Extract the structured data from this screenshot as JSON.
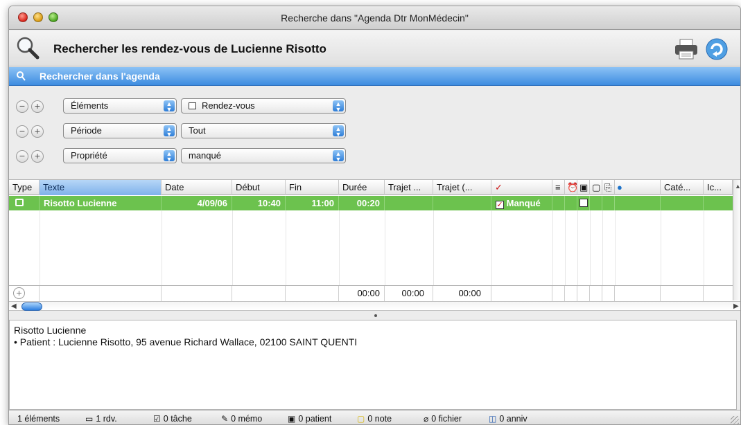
{
  "window": {
    "title": "Recherche dans \"Agenda Dtr MonMédecin\""
  },
  "header": {
    "title": "Rechercher les rendez-vous de Lucienne Risotto",
    "icons": {
      "search": "magnifier-icon",
      "print": "printer-icon",
      "refresh": "refresh-icon"
    }
  },
  "searchbar": {
    "label": "Rechercher dans l'agenda"
  },
  "criteria": [
    {
      "field": "Éléments",
      "value": "Rendez-vous"
    },
    {
      "field": "Période",
      "value": "Tout"
    },
    {
      "field": "Propriété",
      "value": "manqué"
    }
  ],
  "table": {
    "columns": [
      "Type",
      "Texte",
      "Date",
      "Début",
      "Fin",
      "Durée",
      "Trajet ...",
      "Trajet (...",
      "✓",
      "≡",
      "⏰",
      "▣",
      "▢",
      "⎘",
      "●",
      "Caté...",
      "Ic..."
    ],
    "row": {
      "texte": "Risotto Lucienne",
      "date": "4/09/06",
      "debut": "10:40",
      "fin": "11:00",
      "duree": "00:20",
      "manque": "Manqué"
    },
    "footer": {
      "duree": "00:00",
      "trajet1": "00:00",
      "trajet2": "00:00"
    }
  },
  "notes": {
    "line1": "Risotto Lucienne",
    "line2": "• Patient : Lucienne Risotto, 95 avenue Richard Wallace, 02100 SAINT QUENTI"
  },
  "status": {
    "elements": "1 éléments",
    "rdv": "1 rdv.",
    "tache": "0 tâche",
    "memo": "0 mémo",
    "patient": "0 patient",
    "note": "0 note",
    "fichier": "0 fichier",
    "anniv": "0 anniv"
  },
  "colors": {
    "selected_row": "#6cc24e",
    "accent_blue": "#3d8ce0",
    "check_red": "#cc1111"
  }
}
